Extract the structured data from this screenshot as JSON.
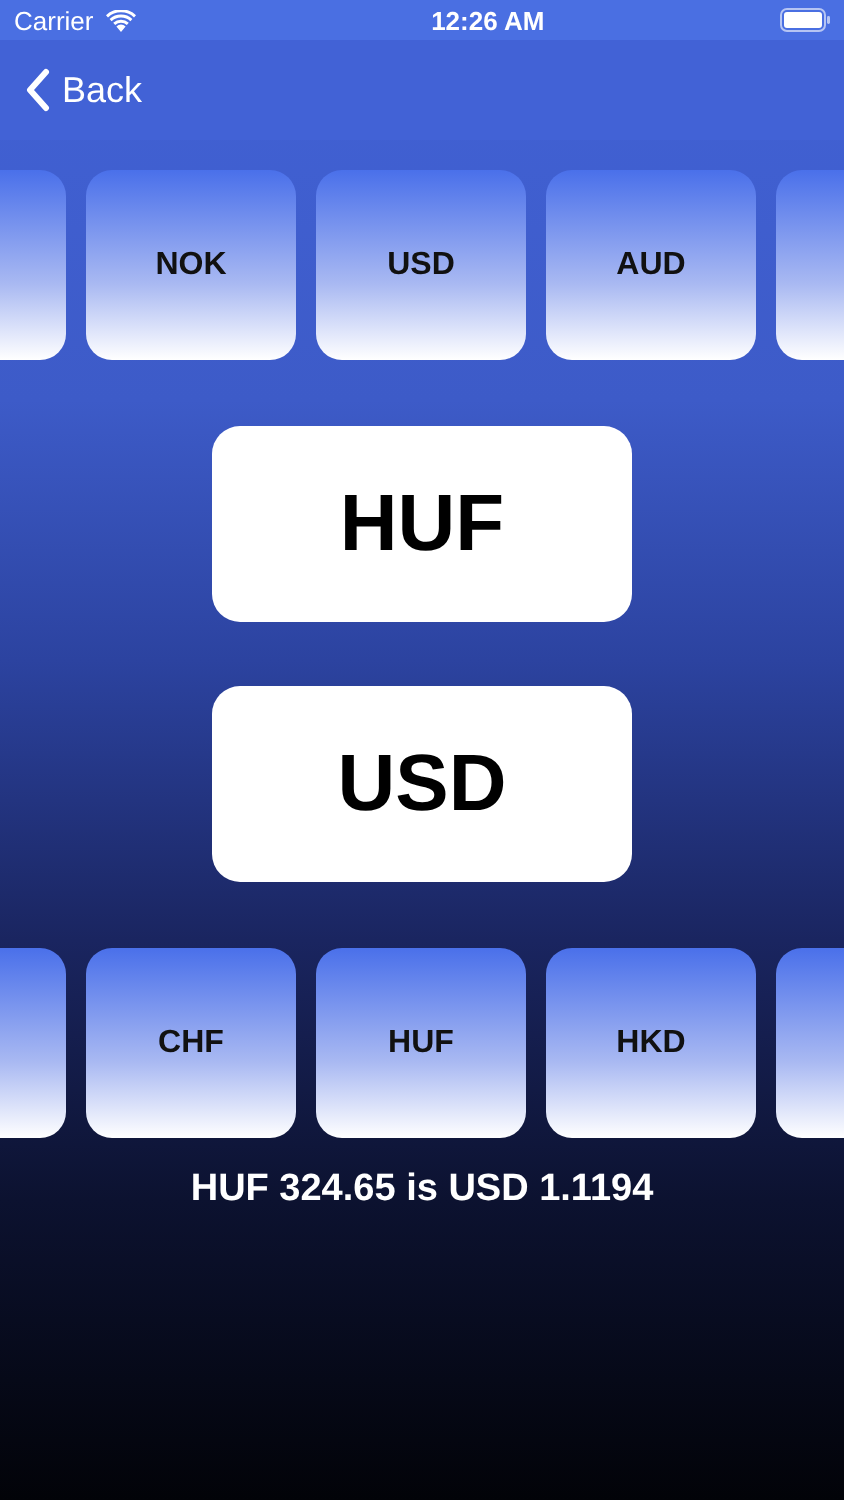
{
  "status_bar": {
    "carrier": "Carrier",
    "time": "12:26 AM"
  },
  "nav": {
    "back": "Back"
  },
  "from_row": {
    "tiles": [
      "NOK",
      "USD",
      "AUD"
    ]
  },
  "from_currency": "HUF",
  "to_currency": "USD",
  "to_row": {
    "tiles": [
      "CHF",
      "HUF",
      "HKD"
    ]
  },
  "result": "HUF 324.65 is USD 1.1194"
}
